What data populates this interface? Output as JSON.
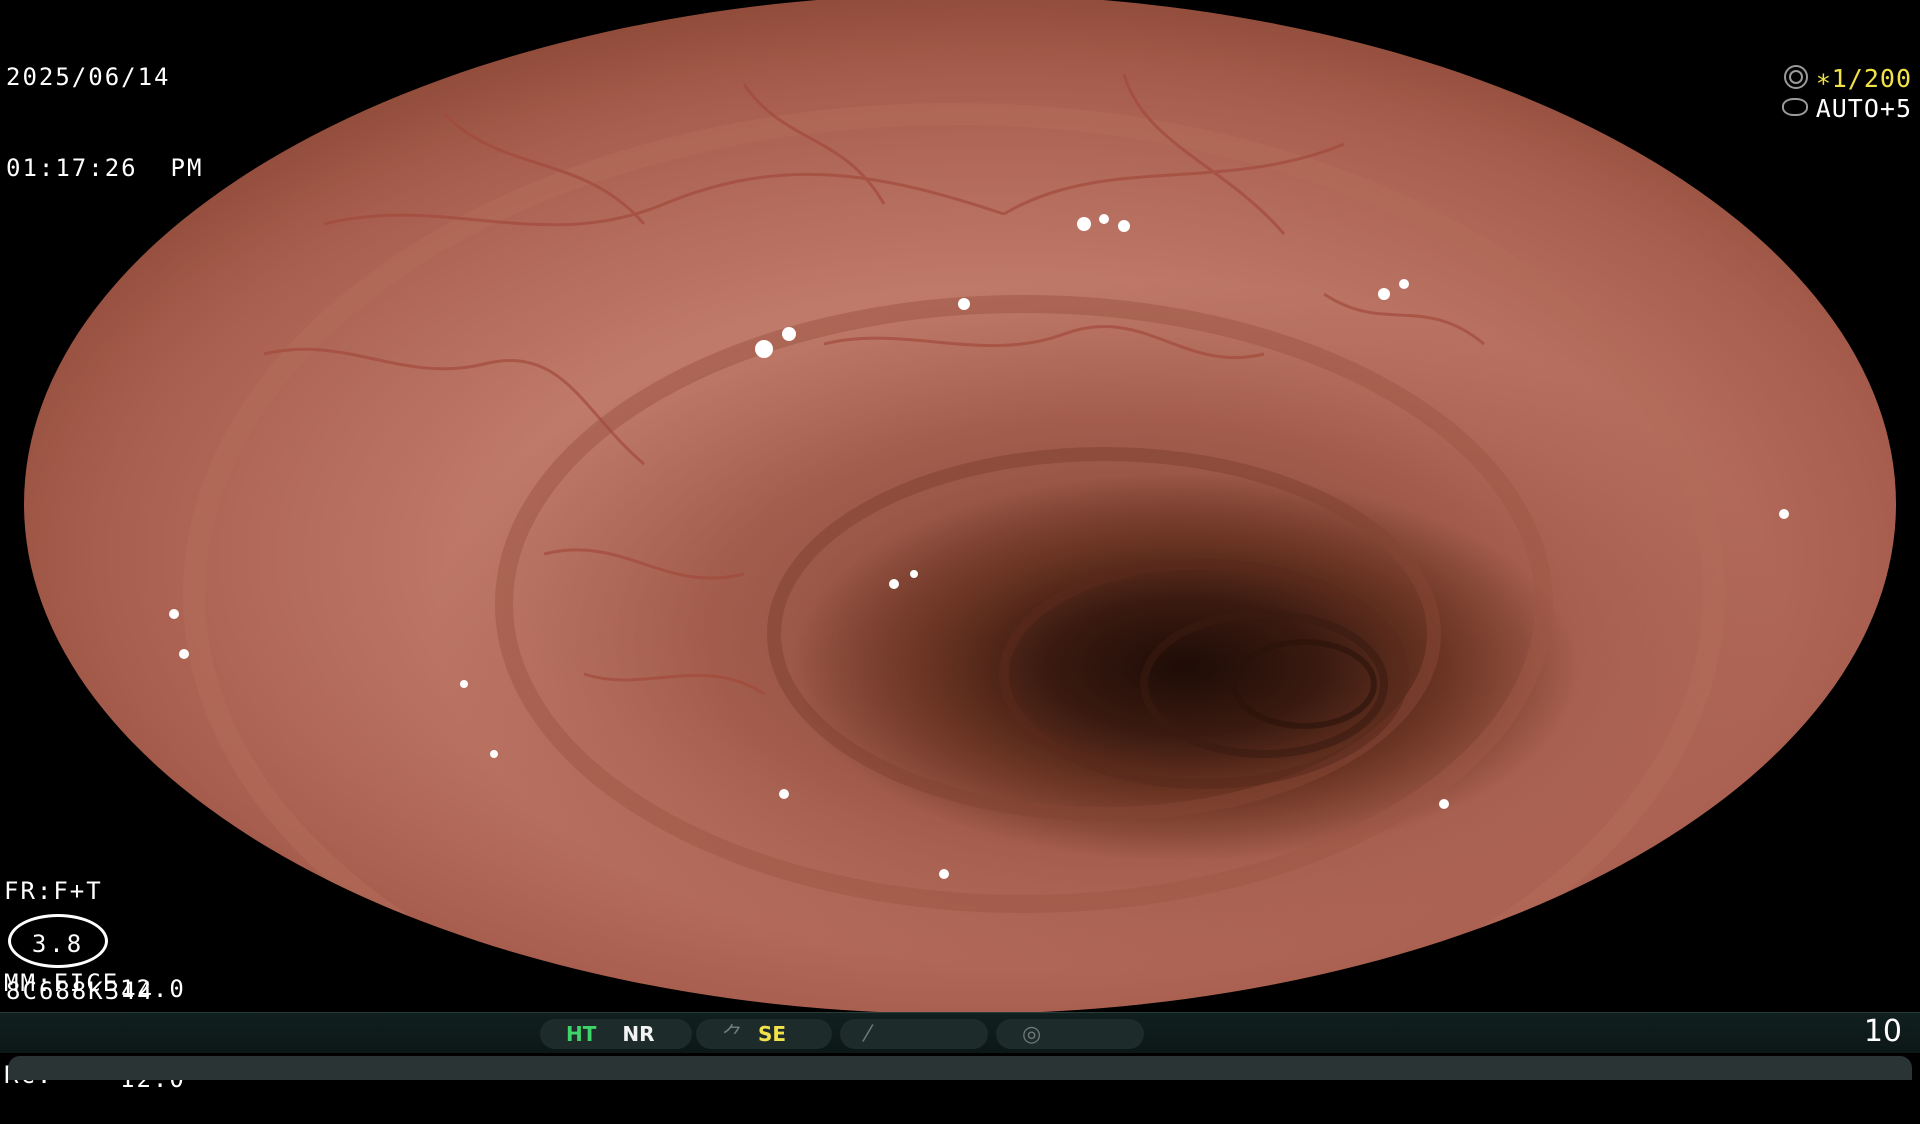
{
  "header": {
    "date": "2025/06/14",
    "time": "01:17:26  PM"
  },
  "camera": {
    "shutter_icon": "shutter-wheel-icon",
    "shutter": "∗1/200",
    "exposure_icon": "exposure-ring-icon",
    "exposure": "AUTO+5"
  },
  "settings": {
    "fr": "FR:F+T",
    "mm": "MM:FICE",
    "rc": "RC:"
  },
  "enhancement": {
    "level": "3.8",
    "value_1": "12.0",
    "value_2": "12.0"
  },
  "scope": {
    "id": "8C688K344"
  },
  "status_bar": {
    "ht": "HT",
    "nr": "NR",
    "se_icon": "structure-enhance-icon",
    "se": "SE",
    "slash_icon": "slash-icon",
    "capture_icon": "capture-icon",
    "ht_color": "#3fd46a",
    "se_color": "#f2e24a",
    "frame_number": "10"
  },
  "colors": {
    "background": "#000000",
    "overlay_text": "#ffffff",
    "shutter_text": "#f2e24a",
    "mucosa": "#c07a6a",
    "lumen": "#1e0c06"
  }
}
